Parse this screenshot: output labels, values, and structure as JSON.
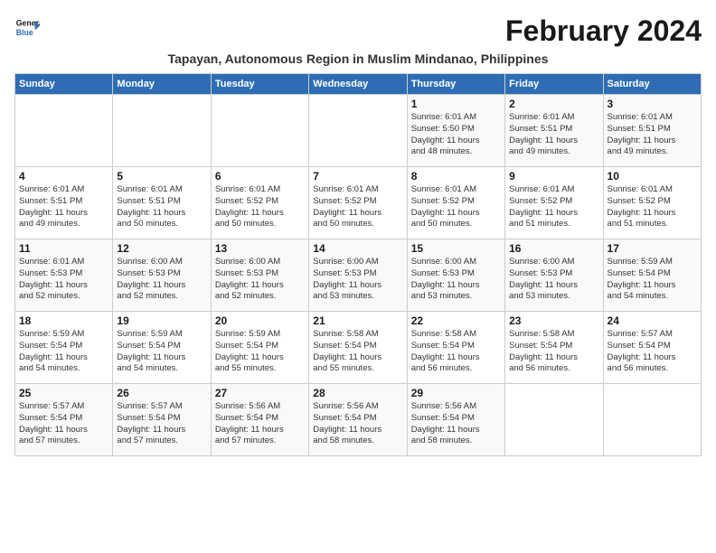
{
  "header": {
    "logo_line1": "General",
    "logo_line2": "Blue",
    "month_title": "February 2024",
    "location": "Tapayan, Autonomous Region in Muslim Mindanao, Philippines"
  },
  "weekdays": [
    "Sunday",
    "Monday",
    "Tuesday",
    "Wednesday",
    "Thursday",
    "Friday",
    "Saturday"
  ],
  "weeks": [
    [
      {
        "day": "",
        "info": ""
      },
      {
        "day": "",
        "info": ""
      },
      {
        "day": "",
        "info": ""
      },
      {
        "day": "",
        "info": ""
      },
      {
        "day": "1",
        "info": "Sunrise: 6:01 AM\nSunset: 5:50 PM\nDaylight: 11 hours\nand 48 minutes."
      },
      {
        "day": "2",
        "info": "Sunrise: 6:01 AM\nSunset: 5:51 PM\nDaylight: 11 hours\nand 49 minutes."
      },
      {
        "day": "3",
        "info": "Sunrise: 6:01 AM\nSunset: 5:51 PM\nDaylight: 11 hours\nand 49 minutes."
      }
    ],
    [
      {
        "day": "4",
        "info": "Sunrise: 6:01 AM\nSunset: 5:51 PM\nDaylight: 11 hours\nand 49 minutes."
      },
      {
        "day": "5",
        "info": "Sunrise: 6:01 AM\nSunset: 5:51 PM\nDaylight: 11 hours\nand 50 minutes."
      },
      {
        "day": "6",
        "info": "Sunrise: 6:01 AM\nSunset: 5:52 PM\nDaylight: 11 hours\nand 50 minutes."
      },
      {
        "day": "7",
        "info": "Sunrise: 6:01 AM\nSunset: 5:52 PM\nDaylight: 11 hours\nand 50 minutes."
      },
      {
        "day": "8",
        "info": "Sunrise: 6:01 AM\nSunset: 5:52 PM\nDaylight: 11 hours\nand 50 minutes."
      },
      {
        "day": "9",
        "info": "Sunrise: 6:01 AM\nSunset: 5:52 PM\nDaylight: 11 hours\nand 51 minutes."
      },
      {
        "day": "10",
        "info": "Sunrise: 6:01 AM\nSunset: 5:52 PM\nDaylight: 11 hours\nand 51 minutes."
      }
    ],
    [
      {
        "day": "11",
        "info": "Sunrise: 6:01 AM\nSunset: 5:53 PM\nDaylight: 11 hours\nand 52 minutes."
      },
      {
        "day": "12",
        "info": "Sunrise: 6:00 AM\nSunset: 5:53 PM\nDaylight: 11 hours\nand 52 minutes."
      },
      {
        "day": "13",
        "info": "Sunrise: 6:00 AM\nSunset: 5:53 PM\nDaylight: 11 hours\nand 52 minutes."
      },
      {
        "day": "14",
        "info": "Sunrise: 6:00 AM\nSunset: 5:53 PM\nDaylight: 11 hours\nand 53 minutes."
      },
      {
        "day": "15",
        "info": "Sunrise: 6:00 AM\nSunset: 5:53 PM\nDaylight: 11 hours\nand 53 minutes."
      },
      {
        "day": "16",
        "info": "Sunrise: 6:00 AM\nSunset: 5:53 PM\nDaylight: 11 hours\nand 53 minutes."
      },
      {
        "day": "17",
        "info": "Sunrise: 5:59 AM\nSunset: 5:54 PM\nDaylight: 11 hours\nand 54 minutes."
      }
    ],
    [
      {
        "day": "18",
        "info": "Sunrise: 5:59 AM\nSunset: 5:54 PM\nDaylight: 11 hours\nand 54 minutes."
      },
      {
        "day": "19",
        "info": "Sunrise: 5:59 AM\nSunset: 5:54 PM\nDaylight: 11 hours\nand 54 minutes."
      },
      {
        "day": "20",
        "info": "Sunrise: 5:59 AM\nSunset: 5:54 PM\nDaylight: 11 hours\nand 55 minutes."
      },
      {
        "day": "21",
        "info": "Sunrise: 5:58 AM\nSunset: 5:54 PM\nDaylight: 11 hours\nand 55 minutes."
      },
      {
        "day": "22",
        "info": "Sunrise: 5:58 AM\nSunset: 5:54 PM\nDaylight: 11 hours\nand 56 minutes."
      },
      {
        "day": "23",
        "info": "Sunrise: 5:58 AM\nSunset: 5:54 PM\nDaylight: 11 hours\nand 56 minutes."
      },
      {
        "day": "24",
        "info": "Sunrise: 5:57 AM\nSunset: 5:54 PM\nDaylight: 11 hours\nand 56 minutes."
      }
    ],
    [
      {
        "day": "25",
        "info": "Sunrise: 5:57 AM\nSunset: 5:54 PM\nDaylight: 11 hours\nand 57 minutes."
      },
      {
        "day": "26",
        "info": "Sunrise: 5:57 AM\nSunset: 5:54 PM\nDaylight: 11 hours\nand 57 minutes."
      },
      {
        "day": "27",
        "info": "Sunrise: 5:56 AM\nSunset: 5:54 PM\nDaylight: 11 hours\nand 57 minutes."
      },
      {
        "day": "28",
        "info": "Sunrise: 5:56 AM\nSunset: 5:54 PM\nDaylight: 11 hours\nand 58 minutes."
      },
      {
        "day": "29",
        "info": "Sunrise: 5:56 AM\nSunset: 5:54 PM\nDaylight: 11 hours\nand 58 minutes."
      },
      {
        "day": "",
        "info": ""
      },
      {
        "day": "",
        "info": ""
      }
    ]
  ]
}
